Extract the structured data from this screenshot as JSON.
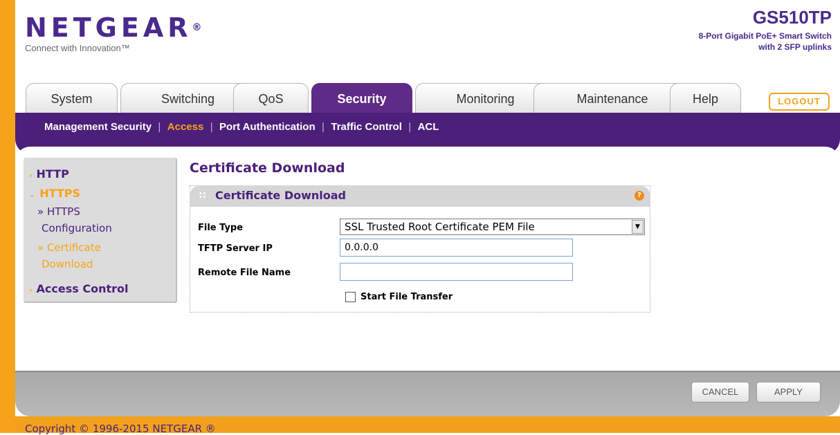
{
  "header": {
    "brand": "NETGEAR",
    "brand_mark": "®",
    "tagline": "Connect with Innovation™",
    "model": "GS510TP",
    "model_desc_line1": "8-Port Gigabit PoE+ Smart Switch",
    "model_desc_line2": "with 2 SFP uplinks"
  },
  "tabs": [
    {
      "label": "System"
    },
    {
      "label": "Switching"
    },
    {
      "label": "QoS"
    },
    {
      "label": "Security"
    },
    {
      "label": "Monitoring"
    },
    {
      "label": "Maintenance"
    },
    {
      "label": "Help"
    }
  ],
  "logout_label": "LOGOUT",
  "subnav": {
    "items": [
      {
        "label": "Management Security"
      },
      {
        "label": "Access"
      },
      {
        "label": "Port Authentication"
      },
      {
        "label": "Traffic Control"
      },
      {
        "label": "ACL"
      }
    ],
    "separator": "|"
  },
  "left_menu": {
    "http": "HTTP",
    "https": "HTTPS",
    "https_config_1": "» HTTPS",
    "https_config_2": "Configuration",
    "cert_download_1": "» Certificate",
    "cert_download_2": "Download",
    "access_control": "Access Control"
  },
  "page_title": "Certificate Download",
  "panel": {
    "title": "Certificate Download",
    "help": "?",
    "file_type_label": "File Type",
    "file_type_value": "SSL Trusted Root Certificate PEM File",
    "tftp_label": "TFTP Server IP",
    "tftp_value": "0.0.0.0",
    "remote_label": "Remote File Name",
    "remote_value": "",
    "start_label": "Start File Transfer"
  },
  "buttons": {
    "cancel": "CANCEL",
    "apply": "APPLY"
  },
  "copyright": "Copyright © 1996-2015 NETGEAR ®",
  "colors": {
    "brand_purple": "#4b1f7a",
    "accent_orange": "#f5a31a"
  }
}
